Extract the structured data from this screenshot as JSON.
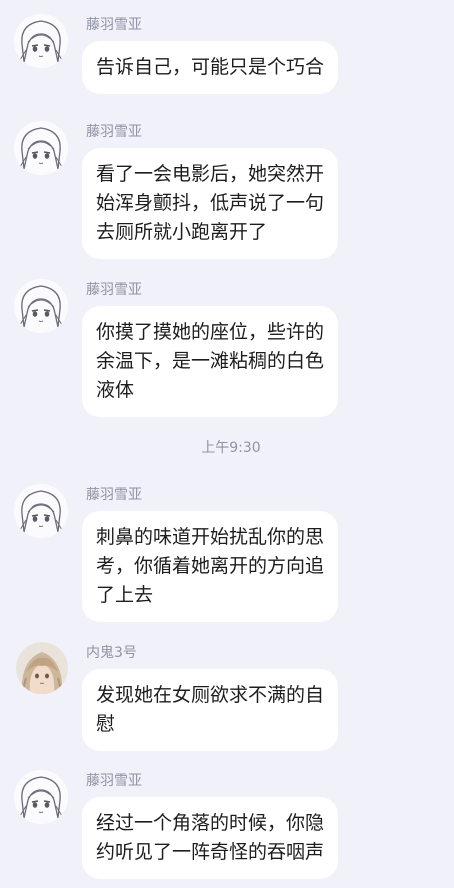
{
  "time_divider": "上午9:30",
  "messages": [
    {
      "sender": "藤羽雪亚",
      "avatar": "anime-girl-avatar",
      "lines": [
        "告诉自己，可能只是个巧合"
      ]
    },
    {
      "sender": "藤羽雪亚",
      "avatar": "anime-girl-avatar",
      "lines": [
        "看了一会电影后，她突然开",
        "始浑身颤抖，低声说了一句",
        "去厕所就小跑离开了"
      ]
    },
    {
      "sender": "藤羽雪亚",
      "avatar": "anime-girl-avatar",
      "lines": [
        "你摸了摸她的座位，些许的",
        "余温下，是一滩粘稠的白色",
        "液体"
      ]
    },
    {
      "sender": "藤羽雪亚",
      "avatar": "anime-girl-avatar",
      "lines": [
        "刺鼻的味道开始扰乱你的思",
        "考，你循着她离开的方向追",
        "了上去"
      ]
    },
    {
      "sender": "内鬼3号",
      "avatar": "blonde-girl-avatar",
      "lines": [
        "发现她在女厕欲求不满的自",
        "慰"
      ]
    },
    {
      "sender": "藤羽雪亚",
      "avatar": "anime-girl-avatar",
      "lines": [
        "经过一个角落的时候，你隐",
        "约听见了一阵奇怪的吞咽声"
      ]
    }
  ]
}
